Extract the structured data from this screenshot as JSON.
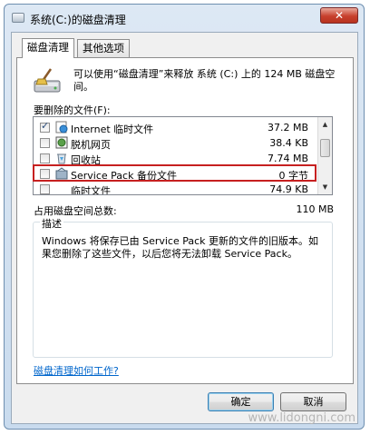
{
  "window": {
    "title": "系统(C:)的磁盘清理",
    "close_label": "✕"
  },
  "tabs": [
    {
      "label": "磁盘清理",
      "active": true
    },
    {
      "label": "其他选项",
      "active": false
    }
  ],
  "info": {
    "text": "可以使用“磁盘清理”来释放 系统 (C:) 上的 124 MB 磁盘空间。"
  },
  "files_label": "要删除的文件(F):",
  "files": [
    {
      "checked": true,
      "icon": "internet-files-icon",
      "name": "Internet 临时文件",
      "size": "37.2 MB"
    },
    {
      "checked": false,
      "icon": "offline-pages-icon",
      "name": "脱机网页",
      "size": "38.4 KB"
    },
    {
      "checked": false,
      "icon": "recycle-bin-icon",
      "name": "回收站",
      "size": "7.74 MB"
    },
    {
      "checked": false,
      "icon": "service-pack-icon",
      "name": "Service Pack 备份文件",
      "size": "0 字节"
    },
    {
      "checked": false,
      "icon": "temp-files-icon",
      "name": "临时文件",
      "size": "74.9 KB"
    }
  ],
  "total": {
    "label": "占用磁盘空间总数:",
    "value": "110 MB"
  },
  "description": {
    "legend": "描述",
    "text": "Windows 将保存已由 Service Pack 更新的文件的旧版本。如果您删除了这些文件，以后您将无法卸载 Service Pack。"
  },
  "help_link": "磁盘清理如何工作?",
  "buttons": {
    "ok": "确定",
    "cancel": "取消"
  },
  "watermark": "www.lidongni.com",
  "colors": {
    "highlight": "#c62020",
    "link": "#0066cc",
    "close": "#c7402d"
  }
}
